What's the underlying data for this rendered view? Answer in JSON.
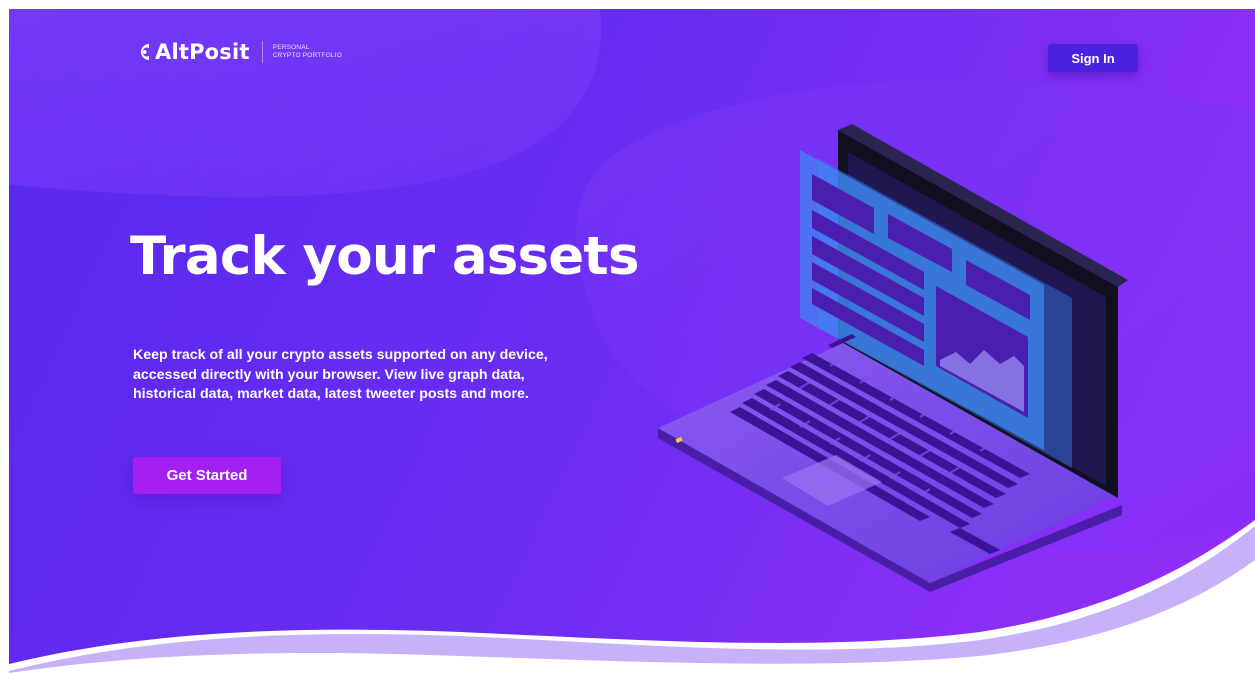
{
  "header": {
    "logo_text": "AltPosit",
    "tagline_line1": "PERSONAL",
    "tagline_line2": "CRYPTO PORTFOLIO",
    "sign_in_label": "Sign In"
  },
  "hero": {
    "headline": "Track your assets",
    "description_lines": [
      "Keep track of all your crypto assets supported on any device,",
      "accessed directly with your browser. View live graph data,",
      "historical data, market data, latest tweeter posts and more."
    ],
    "cta_label": "Get Started"
  },
  "colors": {
    "gradient_left": "#5a2bf0",
    "gradient_right": "#8b2cf5",
    "sign_in_bg": "#4a23e0",
    "cta_bg": "#a41ff2"
  },
  "icons": {
    "logo": "altposit-logo-icon",
    "illustration": "laptop-illustration"
  }
}
